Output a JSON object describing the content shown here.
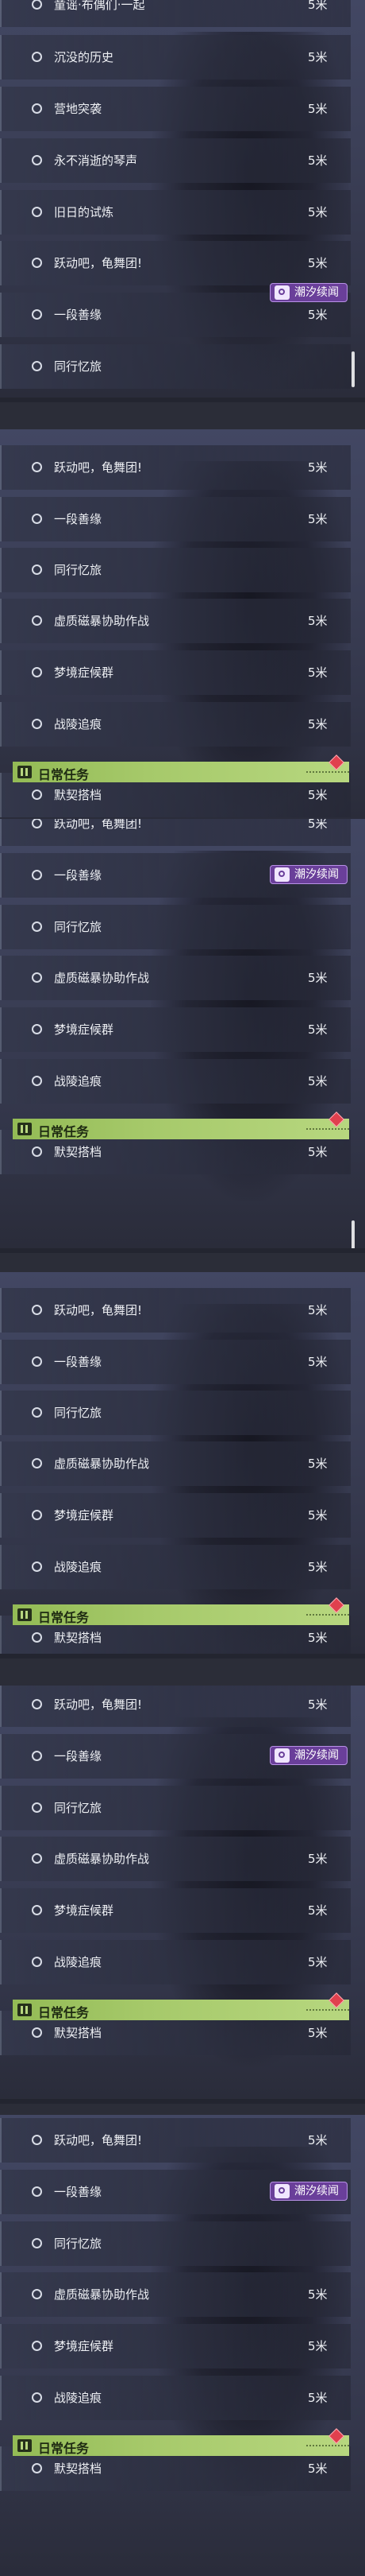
{
  "panels": [
    {
      "rows": [
        {
          "name": "童谣·布偶们·一起",
          "distance": "5米"
        },
        {
          "name": "沉没的历史",
          "distance": "5米"
        },
        {
          "name": "营地突袭",
          "distance": "5米"
        },
        {
          "name": "永不消逝的琴声",
          "distance": "5米"
        },
        {
          "name": "旧日的试炼",
          "distance": "5米"
        },
        {
          "name": "跃动吧，龟舞团!",
          "distance": "5米"
        },
        {
          "name": "一段善缘",
          "distance": "5米"
        },
        {
          "name": "同行忆旅",
          "distance": ""
        }
      ],
      "tag": "潮汐续闻"
    },
    {
      "rows": [
        {
          "name": "跃动吧，龟舞团!",
          "distance": "5米"
        },
        {
          "name": "一段善缘",
          "distance": "5米"
        },
        {
          "name": "同行忆旅",
          "distance": ""
        },
        {
          "name": "虚质磁暴协助作战",
          "distance": "5米"
        },
        {
          "name": "梦境症候群",
          "distance": "5米"
        },
        {
          "name": "战陵追痕",
          "distance": "5米"
        },
        {
          "name": "默契搭档",
          "distance": "5米"
        }
      ],
      "section": "日常任务"
    },
    {
      "rows": [
        {
          "name": "跃动吧，龟舞团!",
          "distance": "5米"
        },
        {
          "name": "一段善缘",
          "distance": "5米"
        },
        {
          "name": "同行忆旅",
          "distance": ""
        },
        {
          "name": "虚质磁暴协助作战",
          "distance": "5米"
        },
        {
          "name": "梦境症候群",
          "distance": "5米"
        },
        {
          "name": "战陵追痕",
          "distance": "5米"
        },
        {
          "name": "默契搭档",
          "distance": "5米"
        }
      ],
      "tag": "潮汐续闻",
      "section": "日常任务"
    },
    {
      "rows": [
        {
          "name": "跃动吧，龟舞团!",
          "distance": "5米"
        },
        {
          "name": "一段善缘",
          "distance": "5米"
        },
        {
          "name": "同行忆旅",
          "distance": ""
        },
        {
          "name": "虚质磁暴协助作战",
          "distance": "5米"
        },
        {
          "name": "梦境症候群",
          "distance": "5米"
        },
        {
          "name": "战陵追痕",
          "distance": "5米"
        },
        {
          "name": "默契搭档",
          "distance": "5米"
        }
      ],
      "tag": "潮汐续闻",
      "section": "日常任务"
    },
    {
      "rows": [
        {
          "name": "跃动吧，龟舞团!",
          "distance": "5米"
        },
        {
          "name": "一段善缘",
          "distance": "5米"
        },
        {
          "name": "同行忆旅",
          "distance": ""
        },
        {
          "name": "虚质磁暴协助作战",
          "distance": "5米"
        },
        {
          "name": "梦境症候群",
          "distance": "5米"
        },
        {
          "name": "战陵追痕",
          "distance": "5米"
        },
        {
          "name": "默契搭档",
          "distance": "5米"
        }
      ],
      "tag": "潮汐续闻",
      "section": "日常任务"
    },
    {
      "rows": [
        {
          "name": "跃动吧，龟舞团!",
          "distance": "5米"
        },
        {
          "name": "一段善缘",
          "distance": "5米"
        },
        {
          "name": "同行忆旅",
          "distance": ""
        },
        {
          "name": "虚质磁暴协助作战",
          "distance": "5米"
        },
        {
          "name": "梦境症候群",
          "distance": "5米"
        },
        {
          "name": "战陵追痕",
          "distance": "5米"
        },
        {
          "name": "默契搭档",
          "distance": "5米"
        }
      ],
      "tag": "潮汐续闻",
      "section": "日常任务"
    }
  ],
  "icons": {
    "row": "circle-outline-icon",
    "tag": "tidal-icon",
    "section": "book-icon",
    "alert": "red-diamond-alert-icon"
  },
  "colors": {
    "section_bg": "#a6c96a",
    "tag_bg": "#6a3f9a",
    "alert": "#e0404e"
  }
}
